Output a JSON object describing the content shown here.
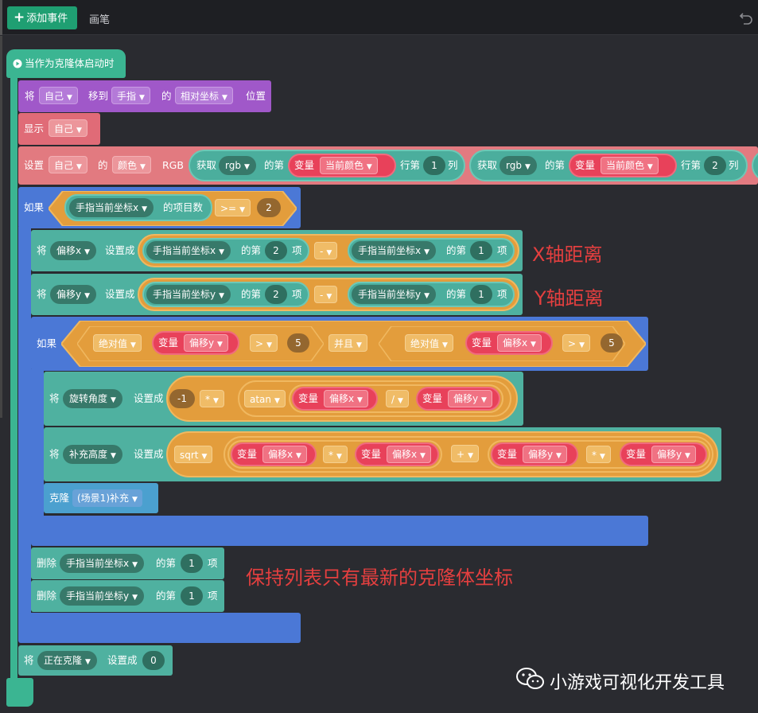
{
  "toolbar": {
    "add_event": "添加事件",
    "pen_tab": "画笔"
  },
  "hat": {
    "label": "当作为克隆体启动时"
  },
  "move": {
    "prefix": "将",
    "who": "自己",
    "to": "移到",
    "target": "手指",
    "of": "的",
    "coord": "相对坐标",
    "pos": "位置"
  },
  "show": {
    "label": "显示",
    "who": "自己"
  },
  "color": {
    "set": "设置",
    "who": "自己",
    "of": "的",
    "prop": "颜色",
    "rgb": "RGB",
    "get": "获取",
    "rgb_mode": "rgb",
    "nth": "的第",
    "var": "变量",
    "var_name": "当前颜色",
    "row": "行第",
    "col": "列",
    "c1": "1",
    "c2": "2"
  },
  "if1": {
    "label": "如果",
    "list": "手指当前坐标x",
    "count": "的项目数",
    "op": ">=",
    "val": "2"
  },
  "setx": {
    "prefix": "将",
    "var": "偏移x",
    "set": "设置成",
    "list": "手指当前坐标x",
    "nth": "的第",
    "n1": "2",
    "item": "项",
    "op": "-",
    "n2": "1"
  },
  "sety": {
    "prefix": "将",
    "var": "偏移y",
    "set": "设置成",
    "list": "手指当前坐标y",
    "nth": "的第",
    "n1": "2",
    "item": "项",
    "op": "-",
    "n2": "1"
  },
  "if2": {
    "label": "如果",
    "abs": "绝对值",
    "var": "变量",
    "vy": "偏移y",
    "vx": "偏移x",
    "gt": ">",
    "five": "5",
    "and": "并且"
  },
  "rot": {
    "prefix": "将",
    "var": "旋转角度",
    "set": "设置成",
    "neg": "-1",
    "mul": "*",
    "fn": "atan",
    "v": "变量",
    "vx": "偏移x",
    "div": "/",
    "vy": "偏移y"
  },
  "fill": {
    "prefix": "将",
    "var": "补充高度",
    "set": "设置成",
    "fn": "sqrt",
    "v": "变量",
    "vx": "偏移x",
    "mul": "*",
    "plus": "+",
    "vy": "偏移y"
  },
  "clone": {
    "label": "克隆",
    "target": "(场景1)补充"
  },
  "del1": {
    "label": "删除",
    "list": "手指当前坐标x",
    "nth": "的第",
    "n": "1",
    "item": "项"
  },
  "del2": {
    "label": "删除",
    "list": "手指当前坐标y",
    "nth": "的第",
    "n": "1",
    "item": "项"
  },
  "cloning": {
    "prefix": "将",
    "var": "正在克隆",
    "set": "设置成",
    "val": "0"
  },
  "annotations": {
    "x": "X轴距离",
    "y": "Y轴距离",
    "keep": "保持列表只有最新的克隆体坐标"
  },
  "watermark": "小游戏可视化开发工具",
  "colors": {
    "event": "#3bb592",
    "looks": "#a058c9",
    "pen": "#e27a80",
    "control": "#4b78d6",
    "data": "#4fb1a0",
    "operator": "#e39d3c",
    "variable": "#e04a5d",
    "annotation": "#e43f3f"
  }
}
